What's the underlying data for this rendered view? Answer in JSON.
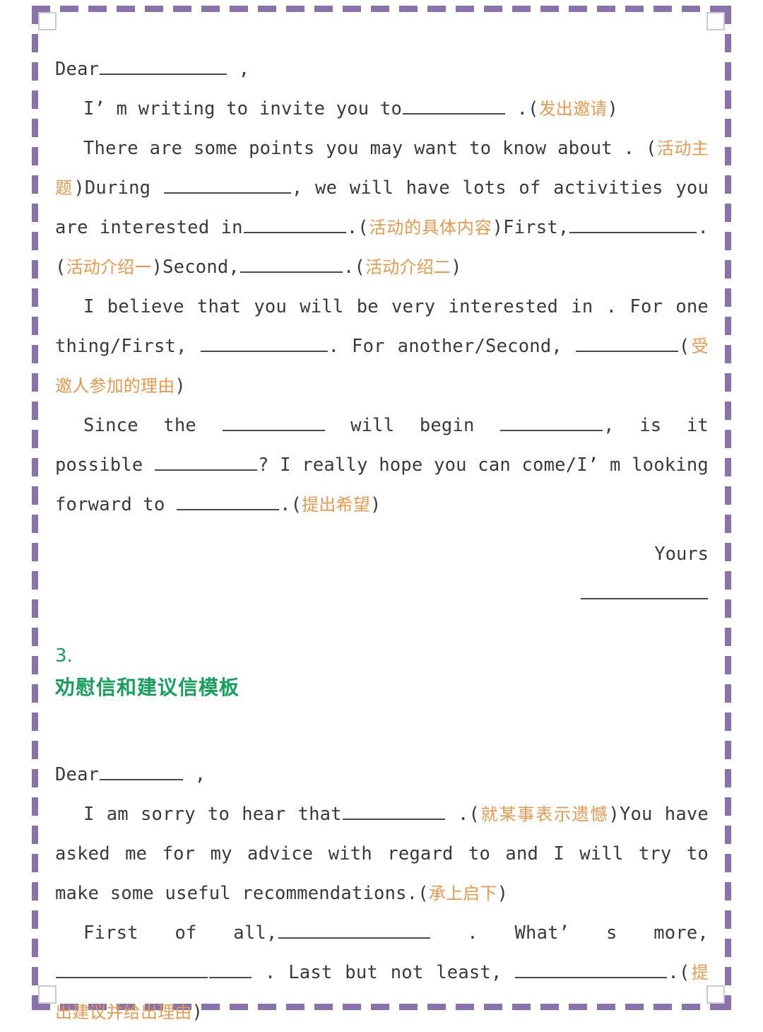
{
  "document": {
    "type": "english-letter-template-worksheet",
    "frame_color": "#8a72ad",
    "annotation_color": "#e79a4f",
    "heading_color": "#16a05c",
    "body_color": "#3a3a3a"
  },
  "invitation_letter": {
    "salutation": "Dear",
    "salutation_comma": ",",
    "p1": {
      "t1": "I’ m writing to invite you to",
      "t2": ".(",
      "note": "发出邀请",
      "t3": ")"
    },
    "p2": {
      "t1": "There are some points you may want to know about",
      "t2": ". (",
      "note1": "活动主题",
      "t3": ")During",
      "t4": ", we will have lots of activities you are interested in",
      "t5": ".(",
      "note2": "活动的具体内容",
      "t6": ")First,",
      "t7": ".(",
      "note3": "活动介绍一",
      "t8": ")Second,",
      "t9": ".(",
      "note4": "活动介绍二",
      "t10": ")"
    },
    "p3": {
      "t1": "I believe that you will be very interested in . For one thing/First,",
      "t2": ". For another/Second,",
      "t3": "(",
      "note": "受邀人参加的理由",
      "t4": ")"
    },
    "p4": {
      "t1": "Since the",
      "t2": "will begin",
      "t3": ", is it possible",
      "t4": "? I really hope you can come/I’ m looking forward to",
      "t5": ".(",
      "note": "提出希望",
      "t6": ")"
    },
    "closing": "Yours"
  },
  "section3": {
    "number": "3.",
    "title": "劝慰信和建议信模板"
  },
  "advice_letter": {
    "salutation": "Dear",
    "salutation_comma": ",",
    "p1": {
      "t1": "I am sorry to hear that",
      "t2": ".(",
      "note1": "就某事表示遗憾",
      "t3": ")You have asked me for my advice with regard to and I will try to make some useful recommendations.(",
      "note2": "承上启下",
      "t4": ")"
    },
    "p2": {
      "t1": "First of all,",
      "t2": ". What’ s more,",
      "t3": ". Last but not least,",
      "t4": ".(",
      "note": "提出建议并给出理由",
      "t5": ")"
    }
  }
}
